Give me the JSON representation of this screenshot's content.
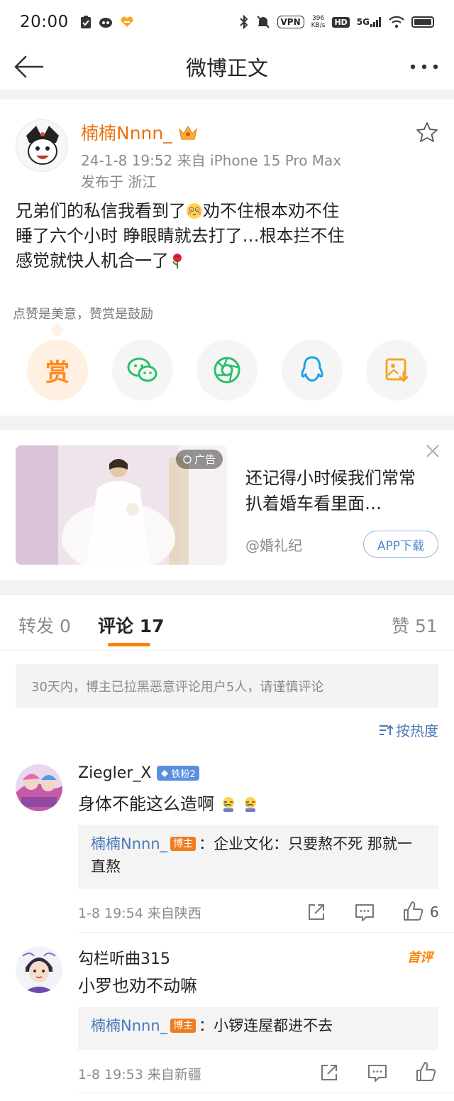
{
  "status_bar": {
    "time": "20:00",
    "network_speed_value": "396",
    "network_speed_unit": "KB/s",
    "vpn": "VPN",
    "hd": "HD",
    "signal": "5G"
  },
  "nav": {
    "title": "微博正文"
  },
  "post": {
    "username": "楠楠Nnnn_",
    "meta": "24-1-8 19:52  来自 iPhone 15 Pro Max",
    "location": "发布于 浙江",
    "lines": [
      {
        "before": "兄弟们的私信我看到了",
        "after": "劝不住根本劝不住"
      },
      {
        "before": "睡了六个小时 睁眼睛就去打了…根本拦不住",
        "after": ""
      },
      {
        "before": "感觉就快人机合一了",
        "after": ""
      }
    ],
    "reward_tip": "点赞是美意，赞赏是鼓励",
    "reward_label": "赏"
  },
  "ad": {
    "badge": "广告",
    "title": "还记得小时候我们常常扒着婚车看里面…",
    "source": "@婚礼纪",
    "cta": "APP下载"
  },
  "tabs": {
    "repost": "转发 0",
    "comments": "评论 17",
    "likes": "赞 51"
  },
  "notice": "30天内，博主已拉黑恶意评论用户5人，请谨慎评论",
  "sort_label": "按热度",
  "comments": [
    {
      "username": "Ziegler_X",
      "fan_badge": "铁粉2",
      "text": "身体不能这么造啊",
      "reply_user": "楠楠Nnnn_",
      "reply_badge": "博主",
      "reply_text": "：企业文化：只要熬不死 那就一直熬",
      "meta": "1-8 19:54  来自陕西",
      "likes": "6"
    },
    {
      "username": "勾栏听曲315",
      "first_badge": "首评",
      "text": "小罗也劝不动嘛",
      "reply_user": "楠楠Nnnn_",
      "reply_badge": "博主",
      "reply_text": "：小锣连屋都进不去",
      "meta": "1-8 19:53  来自新疆"
    }
  ]
}
